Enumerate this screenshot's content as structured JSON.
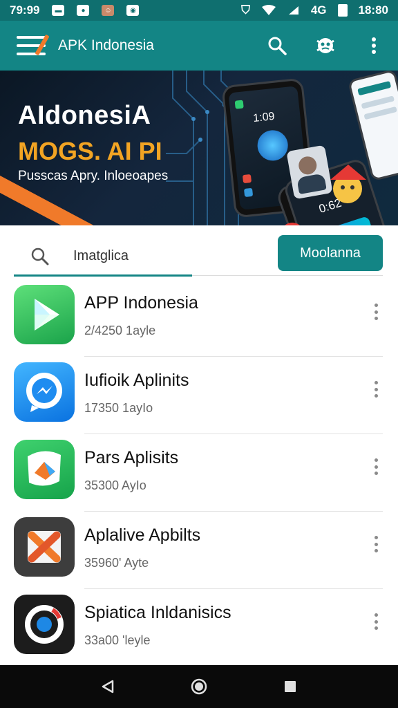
{
  "status_bar": {
    "time_left": "79:99",
    "time_right": "18:80",
    "signal_label": "4G"
  },
  "app_bar": {
    "title": "APK Indonesia"
  },
  "banner": {
    "headline": "AIdonesiA",
    "subheadline": "MOGS. AI PI",
    "tagline": "Pusscas Apry. Inloeoapes",
    "phone_clock_1": "1:09",
    "phone_clock_2": "0:62"
  },
  "search": {
    "value": "Imatglica",
    "button_label": "Moolanna"
  },
  "apps": [
    {
      "name": "APP Indonesia",
      "meta": "2/4250 1ayle"
    },
    {
      "name": "Iufioik Aplinits",
      "meta": "17350 1ayIo"
    },
    {
      "name": "Pars Aplisits",
      "meta": "35300 AyIo"
    },
    {
      "name": "Aplalive Apbilts",
      "meta": "35960' Ayte"
    },
    {
      "name": "Spiatica Inldanisics",
      "meta": "33a00 'leyle"
    }
  ],
  "colors": {
    "primary": "#138585",
    "status_bar": "#0f6f6f",
    "accent_orange": "#f07a2a",
    "accent_yellow": "#f2a423"
  },
  "icons": {
    "menu": "menu-icon",
    "search": "search-icon",
    "bug": "bug-icon",
    "more": "more-vert-icon",
    "back": "back-icon",
    "home": "home-icon",
    "recents": "recents-icon"
  }
}
